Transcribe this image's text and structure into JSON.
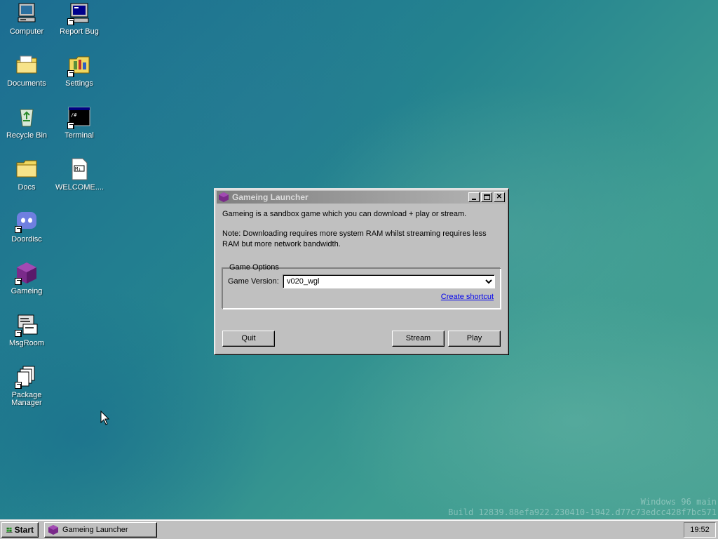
{
  "desktop": {
    "icons": [
      {
        "label": "Computer",
        "icon": "computer-icon"
      },
      {
        "label": "Report Bug",
        "icon": "report-bug-icon"
      },
      {
        "label": "Documents",
        "icon": "documents-folder-icon"
      },
      {
        "label": "Settings",
        "icon": "settings-folder-icon"
      },
      {
        "label": "Recycle Bin",
        "icon": "recycle-bin-icon"
      },
      {
        "label": "Terminal",
        "icon": "terminal-icon"
      },
      {
        "label": "Docs",
        "icon": "folder-icon"
      },
      {
        "label": "WELCOME....",
        "icon": "markdown-file-icon"
      },
      {
        "label": "Doordisc",
        "icon": "doordisc-icon"
      },
      {
        "label": "Gameing",
        "icon": "gameing-cube-icon"
      },
      {
        "label": "MsgRoom",
        "icon": "msgroom-icon"
      },
      {
        "label": "Package Manager",
        "icon": "package-manager-icon"
      }
    ]
  },
  "window": {
    "title": "Gameing Launcher",
    "description": "Gameing is a sandbox game which you can download + play or stream.",
    "note": "Note: Downloading requires more system RAM whilst streaming requires less RAM but more network bandwidth.",
    "options": {
      "legend": "Game Options",
      "version_label": "Game Version:",
      "version_value": "v020_wgl",
      "create_shortcut": "Create shortcut"
    },
    "buttons": {
      "quit": "Quit",
      "stream": "Stream",
      "play": "Play"
    }
  },
  "taskbar": {
    "start_label": "Start",
    "task_label": "Gameing Launcher",
    "clock": "19:52"
  },
  "watermark": {
    "line1": "Windows 96 main",
    "line2": "Build 12839.88efa922.230410-1942.d77c73edcc428f7bc571"
  }
}
